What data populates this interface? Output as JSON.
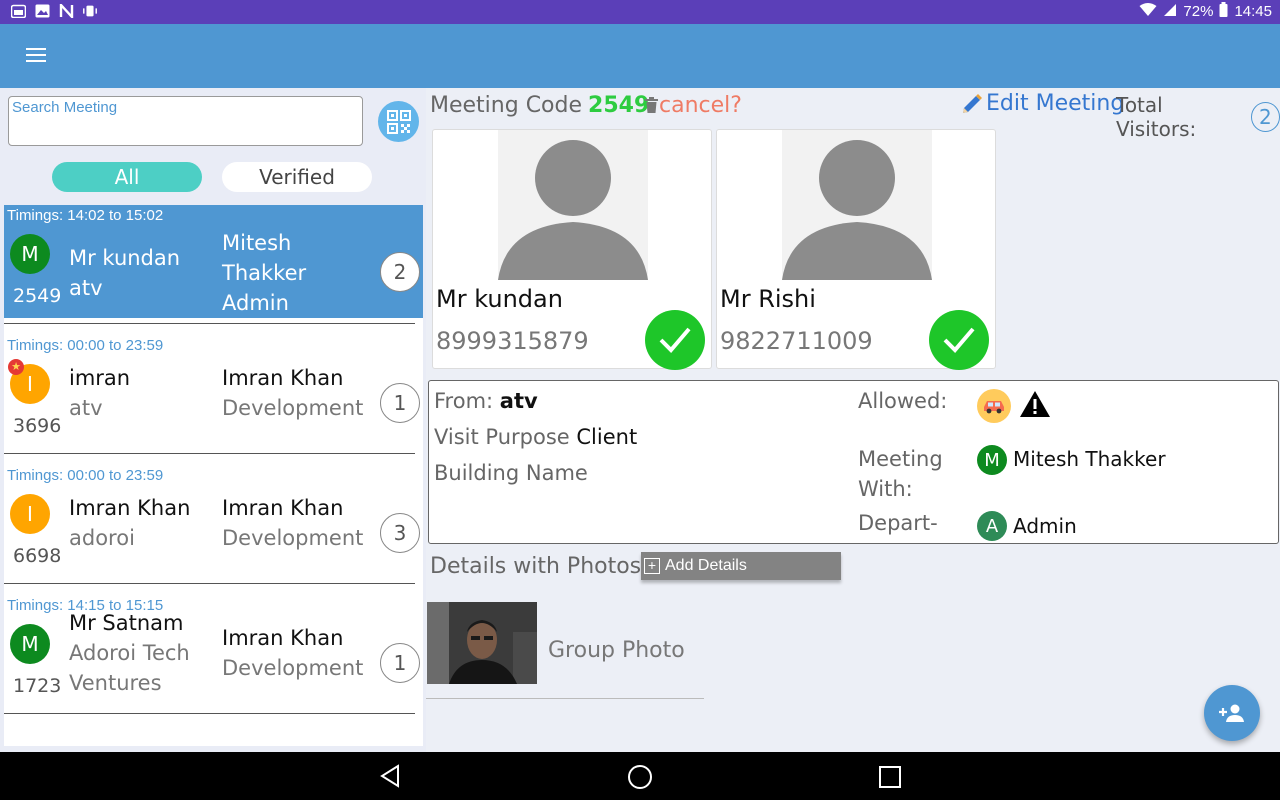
{
  "status_bar": {
    "battery": "72%",
    "time": "14:45",
    "icons": [
      "calendar-icon",
      "image-icon",
      "n-icon",
      "vibrate-icon",
      "wifi-icon",
      "signal-icon",
      "battery-icon"
    ]
  },
  "app_bar": {
    "menu_icon": "hamburger-menu-icon"
  },
  "search": {
    "placeholder": "Search Meeting",
    "qr_icon": "qr-code-icon"
  },
  "filters": {
    "all": "All",
    "verified": "Verified"
  },
  "meetings": [
    {
      "timing": "Timings: 14:02 to 15:02",
      "avatar": "M",
      "avatar_color": "#0d8a1f",
      "code": "2549",
      "visitor_name": "Mr kundan",
      "visitor_company": "atv",
      "host_name": "Mitesh Thakker",
      "host_dept": "Admin",
      "count": "2",
      "selected": true,
      "starred": false
    },
    {
      "timing": "Timings: 00:00 to 23:59",
      "avatar": "I",
      "avatar_color": "#ffa500",
      "code": "3696",
      "visitor_name": "imran",
      "visitor_company": "atv",
      "host_name": "Imran Khan",
      "host_dept": "Development",
      "count": "1",
      "selected": false,
      "starred": true
    },
    {
      "timing": "Timings: 00:00 to 23:59",
      "avatar": "I",
      "avatar_color": "#ffa500",
      "code": "6698",
      "visitor_name": "Imran Khan",
      "visitor_company": "adoroi",
      "host_name": "Imran Khan",
      "host_dept": "Development",
      "count": "3",
      "selected": false,
      "starred": false
    },
    {
      "timing": "Timings: 14:15 to 15:15",
      "avatar": "M",
      "avatar_color": "#0d8a1f",
      "code": "1723",
      "visitor_name": "Mr Satnam",
      "visitor_company": "Adoroi Tech Ventures",
      "host_name": "Imran Khan",
      "host_dept": "Development",
      "count": "1",
      "selected": false,
      "starred": false
    }
  ],
  "detail": {
    "code_label": "Meeting Code",
    "code": "2549",
    "cancel": "cancel?",
    "edit": "Edit Meeting",
    "total_visitors_label": "Total Visitors:",
    "total_visitors": "2",
    "visitors": [
      {
        "name": "Mr kundan",
        "phone": "8999315879"
      },
      {
        "name": "Mr Rishi",
        "phone": "9822711009"
      }
    ],
    "from_label": "From:",
    "from": "atv",
    "purpose_label": "Visit Purpose",
    "purpose": "Client",
    "building_label": "Building Name",
    "allowed_label": "Allowed:",
    "meeting_with_label": "Meeting With:",
    "meeting_with_avatar": "M",
    "meeting_with": "Mitesh Thakker",
    "dept_label": "Depart-",
    "dept_avatar": "A",
    "dept": "Admin",
    "photos_title": "Details with Photos",
    "add_details": "Add Details",
    "group_photo_label": "Group Photo"
  },
  "colors": {
    "primary": "#4f97d2",
    "status_bar": "#5b3fb8",
    "accent_teal": "#4dcfc5",
    "verified_green": "#1ec629",
    "code_green": "#2ecc40",
    "cancel_red": "#ef7b64"
  }
}
